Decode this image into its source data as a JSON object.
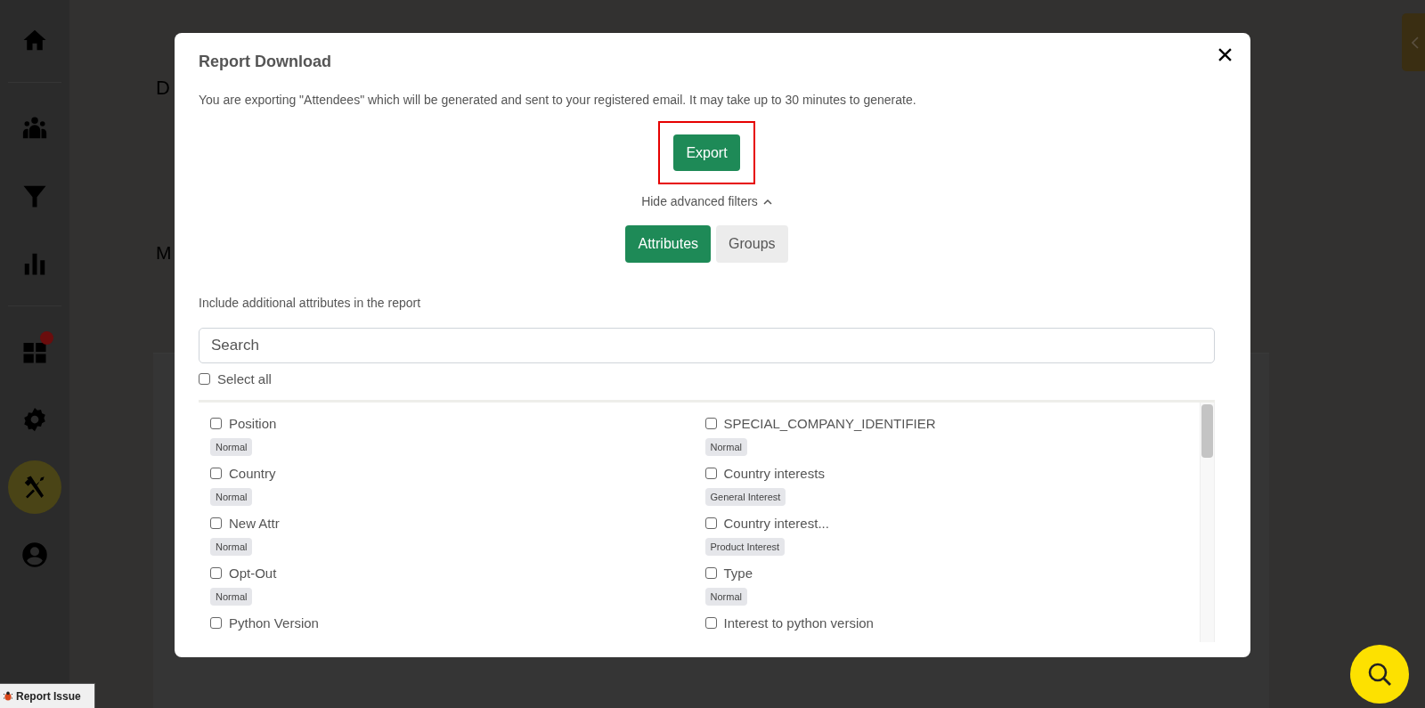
{
  "background": {
    "subtitle": "D",
    "label": "M"
  },
  "sidebar": {
    "groups": [
      [
        {
          "kind": "home",
          "selected": false,
          "notification": false
        }
      ],
      [
        {
          "kind": "people",
          "selected": false,
          "notification": false
        },
        {
          "kind": "filter",
          "selected": false,
          "notification": false
        },
        {
          "kind": "chart",
          "selected": false,
          "notification": false
        }
      ],
      [
        {
          "kind": "grid",
          "selected": false,
          "notification": true
        },
        {
          "kind": "gear",
          "selected": false,
          "notification": false
        },
        {
          "kind": "tools",
          "selected": true,
          "notification": false
        },
        {
          "kind": "user",
          "selected": false,
          "notification": false
        }
      ]
    ]
  },
  "modal": {
    "title": "Report Download",
    "description": "You are exporting \"Attendees\" which will be generated and sent to your registered email. It may take up to 30 minutes to generate.",
    "export_button": {
      "label": "Export",
      "highlighted": true
    },
    "filters_toggle": {
      "label": "Hide advanced filters",
      "expanded": true
    },
    "tabs": [
      {
        "label": "Attributes",
        "selected": true
      },
      {
        "label": "Groups",
        "selected": false
      }
    ],
    "prompt": "Include additional attributes in the report",
    "search": {
      "placeholder": "Search"
    },
    "select_all": {
      "label": "Select all",
      "checked": false
    },
    "attributes": [
      {
        "label": "Position",
        "tag": "Normal",
        "checked": false
      },
      {
        "label": "SPECIAL_COMPANY_IDENTIFIER",
        "tag": "Normal",
        "checked": false
      },
      {
        "label": "Country",
        "tag": "Normal",
        "checked": false
      },
      {
        "label": "Country interests",
        "tag": "General Interest",
        "checked": false
      },
      {
        "label": "New Attr",
        "tag": "Normal",
        "checked": false
      },
      {
        "label": "Country interest...",
        "tag": "Product Interest",
        "checked": false
      },
      {
        "label": "Opt-Out",
        "tag": "Normal",
        "checked": false
      },
      {
        "label": "Type",
        "tag": "Normal",
        "checked": false
      },
      {
        "label": "Python Version",
        "checked": false
      },
      {
        "label": "Interest to python version",
        "checked": false
      }
    ]
  },
  "report_issue": {
    "label": "Report Issue"
  }
}
